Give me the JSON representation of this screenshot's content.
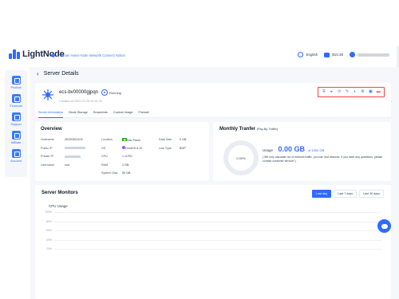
{
  "brand": {
    "name": "LightNode"
  },
  "announcement": "Vietnam Hanoi Node Network Connect Notice",
  "header": {
    "language": "English",
    "balance": "$10.38"
  },
  "sidebar": {
    "items": [
      {
        "label": "Product",
        "icon": "product-icon"
      },
      {
        "label": "Financial",
        "icon": "financial-icon"
      },
      {
        "label": "Support",
        "icon": "support-icon"
      },
      {
        "label": "Affiliate",
        "icon": "affiliate-icon"
      },
      {
        "label": "Account",
        "icon": "account-icon"
      }
    ]
  },
  "page": {
    "title": "Server Details"
  },
  "server": {
    "name": "ecs-bv00000gjpqn",
    "status": "Running",
    "created": "Created at 2022-02-25 20:21:20",
    "actions": [
      {
        "name": "vnc-icon",
        "glyph": "⛨",
        "color": "#2f6bff"
      },
      {
        "name": "start-icon",
        "glyph": "▸",
        "color": "#2f6bff"
      },
      {
        "name": "restart-icon",
        "glyph": "⟳",
        "color": "#2f6bff"
      },
      {
        "name": "edit-icon",
        "glyph": "✎",
        "color": "#2f6bff"
      },
      {
        "name": "reinstall-icon",
        "glyph": "◐",
        "color": "#2f6bff"
      },
      {
        "name": "settings-icon",
        "glyph": "⚙",
        "color": "#2f6bff"
      },
      {
        "name": "lock-icon",
        "glyph": "▣",
        "color": "#2f6bff"
      },
      {
        "name": "delete-icon",
        "glyph": "▬",
        "color": "#ef4444"
      }
    ],
    "tabs": [
      "Server Information",
      "Block Storage",
      "Snapshots",
      "Custom Image",
      "Firewall"
    ]
  },
  "overview": {
    "title": "Overview",
    "rows": [
      [
        "Hostname",
        "20220302103",
        "Location",
        "Sao Paulo",
        "Data Disk",
        "0 GB"
      ],
      [
        "Public IP",
        "",
        "OS",
        "CentOS 6.10",
        "Line Type",
        "BGP"
      ],
      [
        "Private IP",
        "",
        "CPU",
        "1 vCPU",
        "",
        ""
      ],
      [
        "Username",
        "root",
        "RAM",
        "2 GB",
        "",
        ""
      ],
      [
        "",
        "",
        "System Disk",
        "50 GB",
        "",
        ""
      ]
    ]
  },
  "traffic": {
    "title": "Monthly Tranfer",
    "subtitle": "(Pay-By-Traffic)",
    "percent": "0.00%",
    "usage_label": "Usage :",
    "usage_value": "0.00 GB",
    "usage_of": "of 1000 GB",
    "note": "( We only calculate out of network traffic, you can rest assured. If you have any questions, please contact customer service! )"
  },
  "monitors": {
    "title": "Server Monitors",
    "ranges": [
      "Last day",
      "Last 7 days",
      "Last 30 days"
    ],
    "active_range": "Last day",
    "cpu_label": "CPU Usage",
    "ticks": [
      "100%",
      "80%",
      "60%",
      "40%",
      "20%"
    ]
  },
  "colors": {
    "accent": "#2f6bff",
    "danger": "#ef4444"
  }
}
